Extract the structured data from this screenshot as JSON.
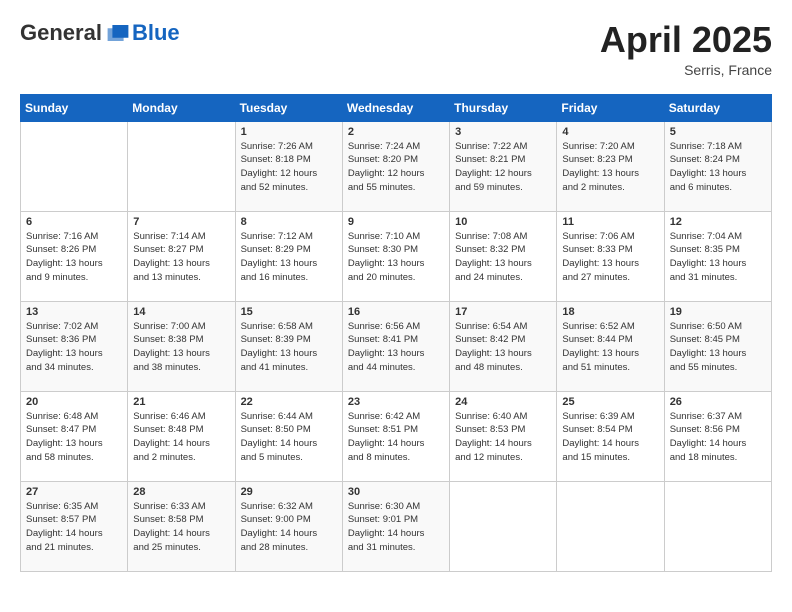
{
  "logo": {
    "general": "General",
    "blue": "Blue"
  },
  "title": {
    "month": "April 2025",
    "location": "Serris, France"
  },
  "days_header": [
    "Sunday",
    "Monday",
    "Tuesday",
    "Wednesday",
    "Thursday",
    "Friday",
    "Saturday"
  ],
  "weeks": [
    [
      {
        "day": "",
        "info": ""
      },
      {
        "day": "",
        "info": ""
      },
      {
        "day": "1",
        "info": "Sunrise: 7:26 AM\nSunset: 8:18 PM\nDaylight: 12 hours\nand 52 minutes."
      },
      {
        "day": "2",
        "info": "Sunrise: 7:24 AM\nSunset: 8:20 PM\nDaylight: 12 hours\nand 55 minutes."
      },
      {
        "day": "3",
        "info": "Sunrise: 7:22 AM\nSunset: 8:21 PM\nDaylight: 12 hours\nand 59 minutes."
      },
      {
        "day": "4",
        "info": "Sunrise: 7:20 AM\nSunset: 8:23 PM\nDaylight: 13 hours\nand 2 minutes."
      },
      {
        "day": "5",
        "info": "Sunrise: 7:18 AM\nSunset: 8:24 PM\nDaylight: 13 hours\nand 6 minutes."
      }
    ],
    [
      {
        "day": "6",
        "info": "Sunrise: 7:16 AM\nSunset: 8:26 PM\nDaylight: 13 hours\nand 9 minutes."
      },
      {
        "day": "7",
        "info": "Sunrise: 7:14 AM\nSunset: 8:27 PM\nDaylight: 13 hours\nand 13 minutes."
      },
      {
        "day": "8",
        "info": "Sunrise: 7:12 AM\nSunset: 8:29 PM\nDaylight: 13 hours\nand 16 minutes."
      },
      {
        "day": "9",
        "info": "Sunrise: 7:10 AM\nSunset: 8:30 PM\nDaylight: 13 hours\nand 20 minutes."
      },
      {
        "day": "10",
        "info": "Sunrise: 7:08 AM\nSunset: 8:32 PM\nDaylight: 13 hours\nand 24 minutes."
      },
      {
        "day": "11",
        "info": "Sunrise: 7:06 AM\nSunset: 8:33 PM\nDaylight: 13 hours\nand 27 minutes."
      },
      {
        "day": "12",
        "info": "Sunrise: 7:04 AM\nSunset: 8:35 PM\nDaylight: 13 hours\nand 31 minutes."
      }
    ],
    [
      {
        "day": "13",
        "info": "Sunrise: 7:02 AM\nSunset: 8:36 PM\nDaylight: 13 hours\nand 34 minutes."
      },
      {
        "day": "14",
        "info": "Sunrise: 7:00 AM\nSunset: 8:38 PM\nDaylight: 13 hours\nand 38 minutes."
      },
      {
        "day": "15",
        "info": "Sunrise: 6:58 AM\nSunset: 8:39 PM\nDaylight: 13 hours\nand 41 minutes."
      },
      {
        "day": "16",
        "info": "Sunrise: 6:56 AM\nSunset: 8:41 PM\nDaylight: 13 hours\nand 44 minutes."
      },
      {
        "day": "17",
        "info": "Sunrise: 6:54 AM\nSunset: 8:42 PM\nDaylight: 13 hours\nand 48 minutes."
      },
      {
        "day": "18",
        "info": "Sunrise: 6:52 AM\nSunset: 8:44 PM\nDaylight: 13 hours\nand 51 minutes."
      },
      {
        "day": "19",
        "info": "Sunrise: 6:50 AM\nSunset: 8:45 PM\nDaylight: 13 hours\nand 55 minutes."
      }
    ],
    [
      {
        "day": "20",
        "info": "Sunrise: 6:48 AM\nSunset: 8:47 PM\nDaylight: 13 hours\nand 58 minutes."
      },
      {
        "day": "21",
        "info": "Sunrise: 6:46 AM\nSunset: 8:48 PM\nDaylight: 14 hours\nand 2 minutes."
      },
      {
        "day": "22",
        "info": "Sunrise: 6:44 AM\nSunset: 8:50 PM\nDaylight: 14 hours\nand 5 minutes."
      },
      {
        "day": "23",
        "info": "Sunrise: 6:42 AM\nSunset: 8:51 PM\nDaylight: 14 hours\nand 8 minutes."
      },
      {
        "day": "24",
        "info": "Sunrise: 6:40 AM\nSunset: 8:53 PM\nDaylight: 14 hours\nand 12 minutes."
      },
      {
        "day": "25",
        "info": "Sunrise: 6:39 AM\nSunset: 8:54 PM\nDaylight: 14 hours\nand 15 minutes."
      },
      {
        "day": "26",
        "info": "Sunrise: 6:37 AM\nSunset: 8:56 PM\nDaylight: 14 hours\nand 18 minutes."
      }
    ],
    [
      {
        "day": "27",
        "info": "Sunrise: 6:35 AM\nSunset: 8:57 PM\nDaylight: 14 hours\nand 21 minutes."
      },
      {
        "day": "28",
        "info": "Sunrise: 6:33 AM\nSunset: 8:58 PM\nDaylight: 14 hours\nand 25 minutes."
      },
      {
        "day": "29",
        "info": "Sunrise: 6:32 AM\nSunset: 9:00 PM\nDaylight: 14 hours\nand 28 minutes."
      },
      {
        "day": "30",
        "info": "Sunrise: 6:30 AM\nSunset: 9:01 PM\nDaylight: 14 hours\nand 31 minutes."
      },
      {
        "day": "",
        "info": ""
      },
      {
        "day": "",
        "info": ""
      },
      {
        "day": "",
        "info": ""
      }
    ]
  ]
}
